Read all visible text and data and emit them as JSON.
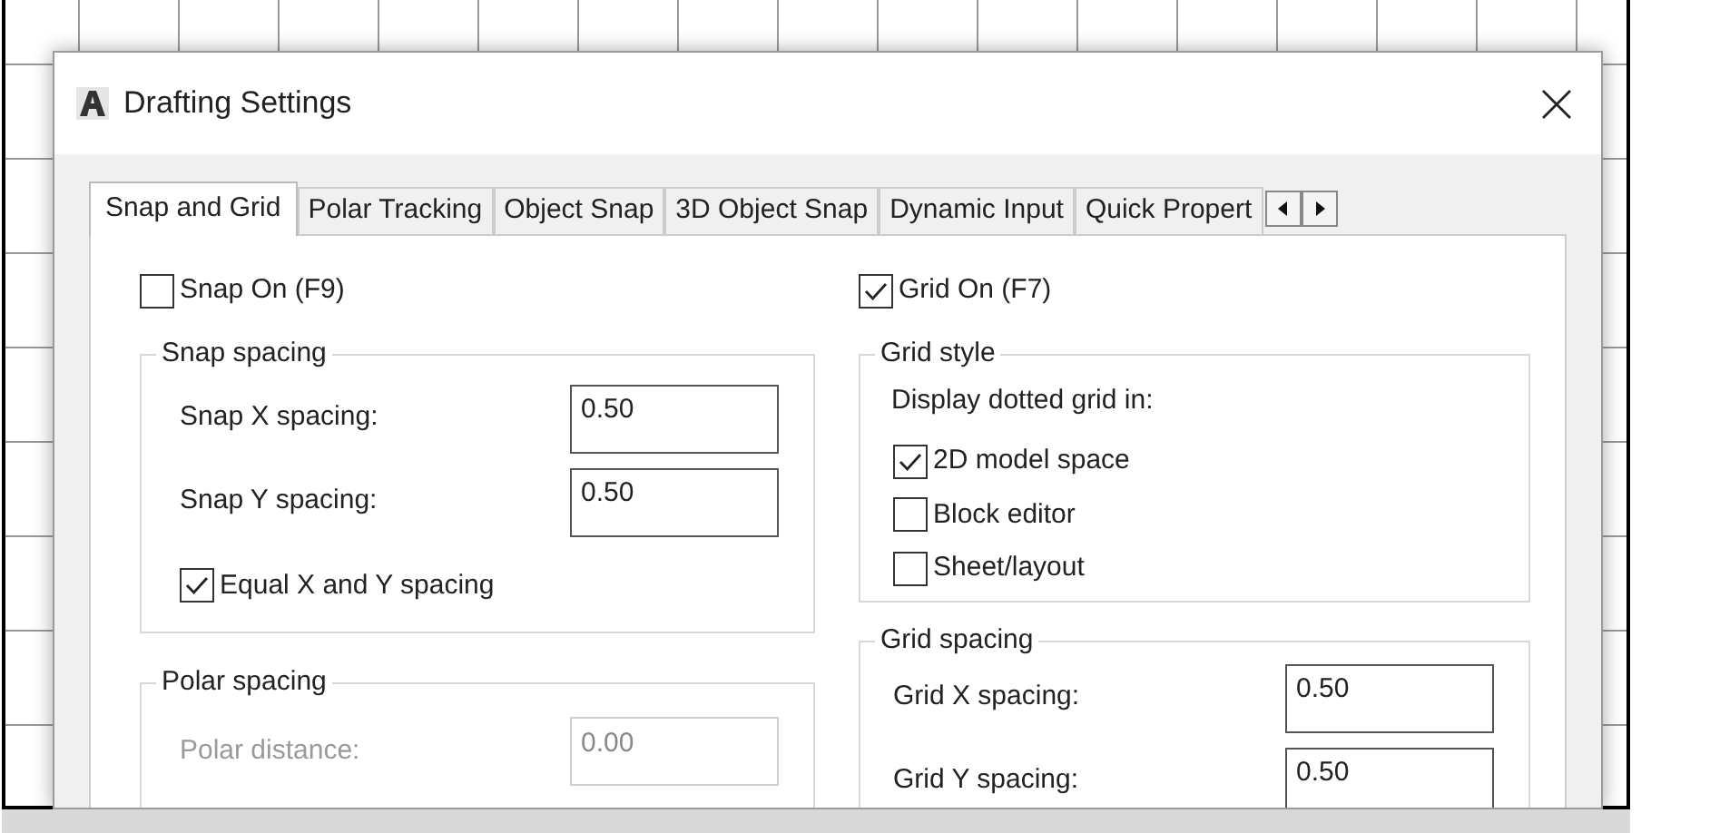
{
  "window": {
    "title": "Drafting Settings"
  },
  "tabs": [
    {
      "label": "Snap and Grid",
      "selected": true
    },
    {
      "label": "Polar Tracking",
      "selected": false
    },
    {
      "label": "Object Snap",
      "selected": false
    },
    {
      "label": "3D Object Snap",
      "selected": false
    },
    {
      "label": "Dynamic Input",
      "selected": false
    },
    {
      "label": "Quick Propert",
      "selected": false
    }
  ],
  "snap_on": {
    "label": "Snap On (F9)",
    "checked": false
  },
  "snap_spacing": {
    "title": "Snap spacing",
    "fields": [
      {
        "label": "Snap X spacing:",
        "value": "0.50",
        "disabled": false
      },
      {
        "label": "Snap Y spacing:",
        "value": "0.50",
        "disabled": false
      }
    ],
    "equal": {
      "label": "Equal X and Y spacing",
      "checked": true
    }
  },
  "polar_spacing": {
    "title": "Polar spacing",
    "fields": [
      {
        "label": "Polar distance:",
        "value": "0.00",
        "disabled": true
      }
    ]
  },
  "grid_on": {
    "label": "Grid On (F7)",
    "checked": true
  },
  "grid_style": {
    "title": "Grid style",
    "caption": "Display dotted grid in:",
    "options": [
      {
        "label": "2D model space",
        "checked": true
      },
      {
        "label": "Block editor",
        "checked": false
      },
      {
        "label": "Sheet/layout",
        "checked": false
      }
    ]
  },
  "grid_spacing": {
    "title": "Grid spacing",
    "fields": [
      {
        "label": "Grid X spacing:",
        "value": "0.50",
        "disabled": false
      },
      {
        "label": "Grid Y spacing:",
        "value": "0.50",
        "disabled": false
      }
    ]
  }
}
